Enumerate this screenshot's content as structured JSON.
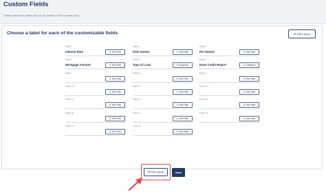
{
  "header": {
    "title": "Custom Fields",
    "subtitle": "Fields with blank labels will not be visible on the Contact Card"
  },
  "card": {
    "title": "Choose a label for each of the customizable fields",
    "edit_layout_label": "Edit Layout"
  },
  "fields": [
    {
      "label": "Field 1",
      "value": "Interest Rate",
      "type": "Text Field",
      "type_icon": "text-a-icon"
    },
    {
      "label": "Field 4",
      "value": "Kids Names",
      "type": "Text Field",
      "type_icon": "text-a-icon"
    },
    {
      "label": "Field 2",
      "value": "Pet Names",
      "type": "Text Field",
      "type_icon": "text-a-icon"
    },
    {
      "label": "Field 3",
      "value": "Mortgage Amount",
      "type": "Text Field",
      "type_icon": "text-a-icon"
    },
    {
      "label": "Field 5",
      "value": "Type of Loan",
      "type": "Dropdown",
      "type_icon": "dropdown-icon"
    },
    {
      "label": "Field 6",
      "value": "Have Credit Report",
      "type": "Checkbox",
      "type_icon": "checkbox-icon"
    },
    {
      "label": "Field 7",
      "value": "",
      "type": "Text Field",
      "type_icon": "text-a-icon"
    },
    {
      "label": "Field 8",
      "value": "",
      "type": "Text Field",
      "type_icon": "text-a-icon"
    },
    {
      "label": "Field 9",
      "value": "",
      "type": "Text Field",
      "type_icon": "text-a-icon"
    },
    {
      "label": "Field 10",
      "value": "",
      "type": "Text Field",
      "type_icon": "text-a-icon"
    },
    {
      "label": "Field 11",
      "value": "",
      "type": "Text Field",
      "type_icon": "text-a-icon"
    },
    {
      "label": "Field 12",
      "value": "",
      "type": "Text Field",
      "type_icon": "text-a-icon"
    },
    {
      "label": "Field 13",
      "value": "",
      "type": "Text Field",
      "type_icon": "text-a-icon"
    },
    {
      "label": "Field 14",
      "value": "",
      "type": "Text Field",
      "type_icon": "text-a-icon"
    },
    {
      "label": "Field 15",
      "value": "",
      "type": "Text Field",
      "type_icon": "text-a-icon"
    },
    {
      "label": "Field 16",
      "value": "",
      "type": "Text Field",
      "type_icon": "text-a-icon"
    },
    {
      "label": "Field 17",
      "value": "",
      "type": "Text Field",
      "type_icon": "text-a-icon"
    },
    {
      "label": "Field 18",
      "value": "",
      "type": "Text Field",
      "type_icon": "text-a-icon"
    },
    {
      "label": "Field 19",
      "value": "",
      "type": "Text Field",
      "type_icon": "text-a-icon"
    },
    {
      "label": "Field 20",
      "value": "",
      "type": "Text Field",
      "type_icon": "text-a-icon"
    }
  ],
  "actions": {
    "edit_layout_label": "Edit Layout",
    "save_label": "Save"
  },
  "colors": {
    "primary": "#1f3a64",
    "highlight": "#e04a4a",
    "header_bg": "#f1f2f5"
  },
  "icons": {
    "edit_layout": "swap-arrows-icon",
    "annotation": "red-arrow-icon"
  }
}
